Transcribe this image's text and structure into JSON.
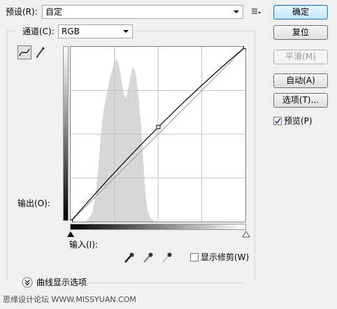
{
  "preset": {
    "label": "预设(R):",
    "value": "自定"
  },
  "channel": {
    "label": "通道(C):",
    "value": "RGB"
  },
  "buttons": {
    "ok": "确定",
    "reset": "复位",
    "smooth": "平滑(M)",
    "auto": "自动(A)",
    "options": "选项(T)..."
  },
  "preview": {
    "label": "预览(P)",
    "checked": true
  },
  "output_label": "输出(O):",
  "input_label": "输入(I):",
  "show_clipping": {
    "label": "显示修剪(W)",
    "checked": false
  },
  "curve_display_options": "曲线显示选项",
  "watermark": "思缘设计论坛 WWW.MISSYUAN.COM",
  "chart_data": {
    "type": "line",
    "x": [
      0,
      128,
      255
    ],
    "y": [
      0,
      138,
      255
    ],
    "xlim": [
      0,
      255
    ],
    "ylim": [
      0,
      255
    ],
    "grid": true,
    "grid_divisions": 4,
    "baseline": true,
    "control_points": [
      [
        0,
        0
      ],
      [
        128,
        138
      ],
      [
        255,
        255
      ]
    ],
    "histogram": [
      0,
      0,
      0,
      0,
      0,
      0,
      0,
      0,
      0,
      0,
      0,
      0,
      0,
      0,
      0,
      0,
      0,
      0,
      0,
      0,
      0,
      0,
      0,
      0,
      1,
      1,
      1,
      2,
      2,
      3,
      3,
      4,
      5,
      6,
      8,
      10,
      12,
      14,
      17,
      20,
      24,
      28,
      32,
      37,
      42,
      47,
      52,
      56,
      60,
      63,
      66,
      68,
      70,
      72,
      74,
      76,
      78,
      80,
      82,
      84,
      86,
      88,
      89,
      90,
      92,
      93,
      94,
      95,
      96,
      97,
      97,
      96,
      95,
      94,
      92,
      90,
      88,
      85,
      82,
      80,
      78,
      76,
      75,
      74,
      74,
      75,
      76,
      78,
      80,
      82,
      84,
      86,
      88,
      90,
      91,
      92,
      92,
      91,
      90,
      88,
      86,
      83,
      80,
      76,
      72,
      68,
      63,
      58,
      52,
      46,
      40,
      34,
      28,
      22,
      17,
      13,
      10,
      8,
      6,
      5,
      4,
      3,
      2,
      2,
      1,
      1,
      1,
      0,
      0,
      0,
      0,
      0,
      0,
      0,
      0,
      0,
      0,
      0,
      0,
      0,
      0,
      0,
      0,
      0,
      0,
      0,
      0,
      0,
      0,
      0,
      0,
      0,
      0,
      0,
      0,
      0,
      0,
      0,
      0,
      0,
      0,
      0,
      0,
      0,
      0,
      0,
      0,
      0,
      0,
      0,
      0,
      0,
      0,
      0,
      0,
      0,
      0,
      0,
      0,
      0,
      0,
      0,
      0,
      0,
      0,
      0,
      0,
      0,
      0,
      0,
      0,
      0,
      0,
      0,
      0,
      0,
      0,
      0,
      0,
      0,
      0,
      0,
      0,
      0,
      0,
      0,
      0,
      0,
      0,
      0,
      0,
      0,
      0,
      0,
      0,
      0,
      0,
      0,
      0,
      0,
      0,
      0,
      0,
      0,
      0,
      0,
      0,
      0,
      0,
      0,
      0,
      0,
      0,
      0,
      0,
      0,
      0,
      0,
      0,
      0,
      0,
      0,
      0,
      0,
      0,
      0,
      0,
      0,
      0,
      0,
      0,
      0,
      0,
      0,
      0,
      0,
      0,
      0,
      0,
      0,
      0,
      0,
      0,
      0,
      0,
      0,
      0,
      0
    ]
  }
}
